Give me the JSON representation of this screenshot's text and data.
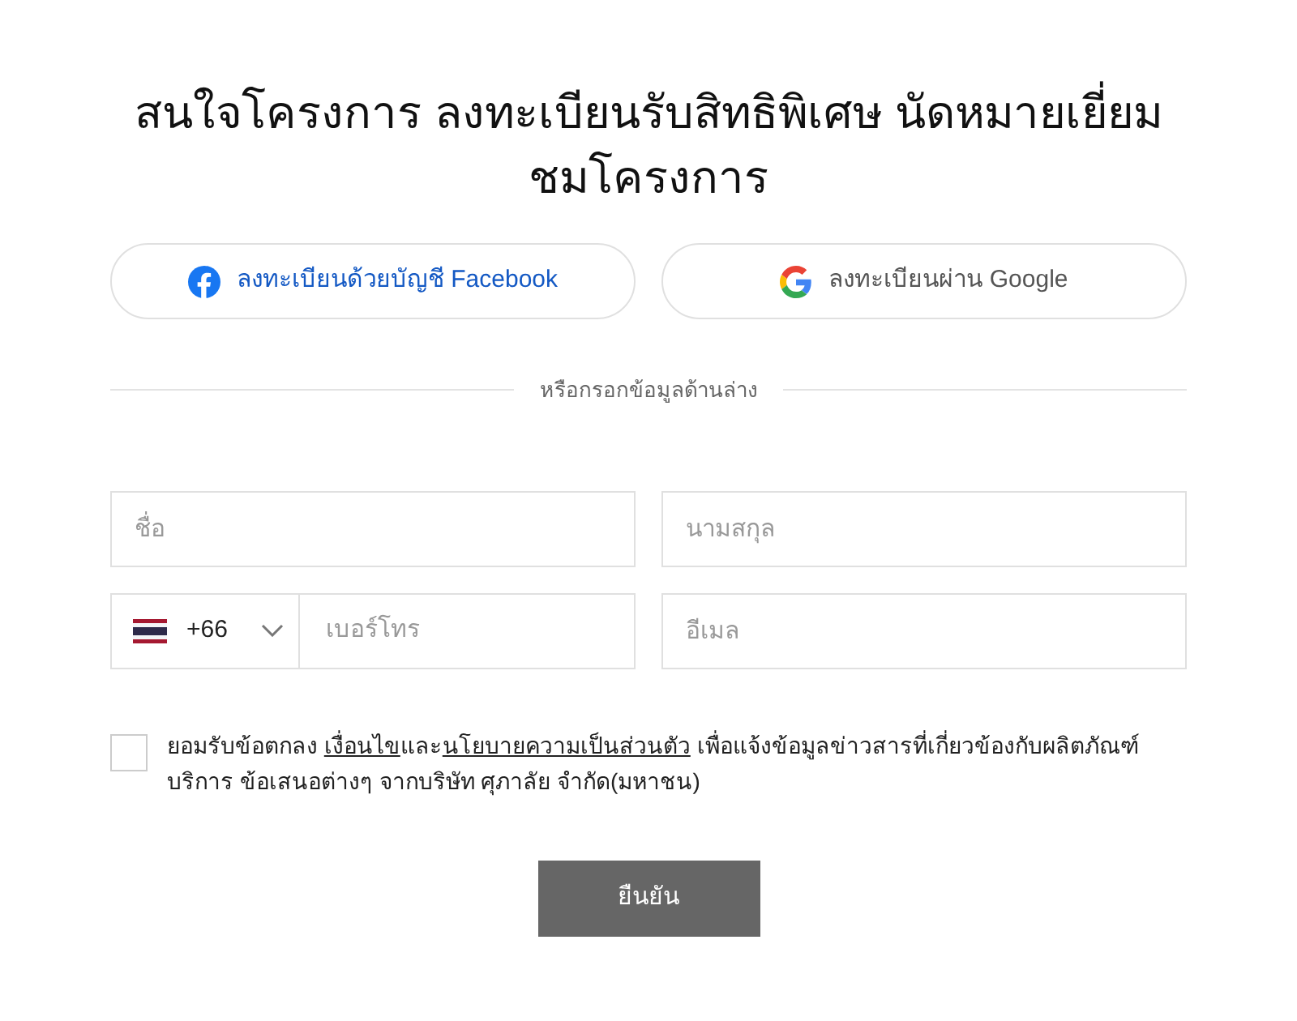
{
  "title": "สนใจโครงการ ลงทะเบียนรับสิทธิพิเศษ นัดหมายเยี่ยมชมโครงการ",
  "social_buttons": [
    {
      "kind": "facebook",
      "label": "ลงทะเบียนด้วยบัญชี Facebook"
    },
    {
      "kind": "google",
      "label": "ลงทะเบียนผ่าน Google"
    }
  ],
  "divider_text": "หรือกรอกข้อมูลด้านล่าง",
  "fields": [
    {
      "kind": "text",
      "placeholder": "ชื่อ"
    },
    {
      "kind": "text",
      "placeholder": "นามสกุล"
    },
    {
      "kind": "phone",
      "country_code": "+66",
      "placeholder": "เบอร์โทร"
    },
    {
      "kind": "text",
      "placeholder": "อีเมล"
    }
  ],
  "consent": {
    "checked": false,
    "parts": [
      {
        "kind": "text",
        "text": "ยอมรับข้อตกลง "
      },
      {
        "kind": "link",
        "text": "เงื่อนไข"
      },
      {
        "kind": "text",
        "text": "และ"
      },
      {
        "kind": "link",
        "text": "นโยบายความเป็นส่วนตัว"
      },
      {
        "kind": "text",
        "text": " เพื่อแจ้งข้อมูลข่าวสารที่เกี่ยวข้องกับผลิตภัณฑ์ บริการ ข้อเสนอต่างๆ จากบริษัท ศุภาลัย จำกัด(มหาชน)"
      }
    ]
  },
  "submit": {
    "label": "ยืนยัน"
  }
}
